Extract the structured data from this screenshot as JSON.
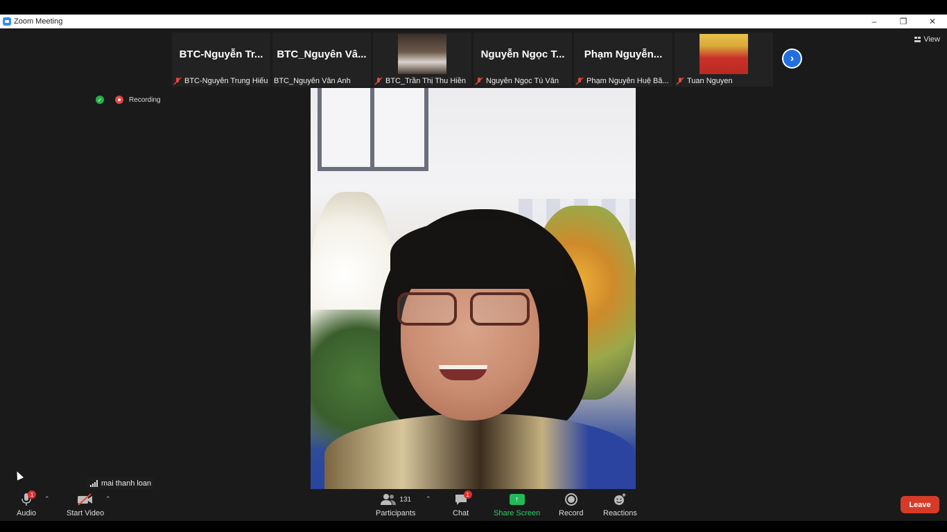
{
  "window": {
    "title": "Zoom Meeting",
    "controls": [
      "–",
      "❐",
      "✕"
    ]
  },
  "view_button": {
    "label": "View"
  },
  "status": {
    "recording_label": "Recording"
  },
  "participant_strip": {
    "tiles": [
      {
        "display": "BTC-Nguyễn  Tr...",
        "name": "BTC-Nguyễn Trung Hiếu",
        "muted": true
      },
      {
        "display": "BTC_Nguyên  Vâ...",
        "name": "BTC_Nguyên  Vân Anh",
        "muted": false
      },
      {
        "display": "",
        "name": "BTC_Trần Thị Thu Hiền",
        "muted": true,
        "has_video": true
      },
      {
        "display": "Nguyễn Ngọc T...",
        "name": "Nguyễn Ngọc Tú Vân",
        "muted": true
      },
      {
        "display": "Phạm  Nguyễn...",
        "name": "Phạm Nguyễn Huệ Bă...",
        "muted": true
      },
      {
        "display": "",
        "name": "Tuan Nguyen",
        "muted": true,
        "has_video": true
      }
    ],
    "next_icon": "chevron-right-icon"
  },
  "active_speaker": {
    "name": "mai thanh loan"
  },
  "toolbar": {
    "audio": {
      "label": "Audio",
      "badge": "1"
    },
    "video": {
      "label": "Start Video"
    },
    "participants": {
      "label": "Participants",
      "count": "131"
    },
    "chat": {
      "label": "Chat",
      "badge": "1"
    },
    "share": {
      "label": "Share Screen"
    },
    "record": {
      "label": "Record"
    },
    "reactions": {
      "label": "Reactions"
    },
    "leave": {
      "label": "Leave"
    }
  },
  "colors": {
    "accent_blue": "#2d8cff",
    "share_green": "#25b85a",
    "leave_red": "#d63a28",
    "badge_red": "#e02e2e"
  }
}
